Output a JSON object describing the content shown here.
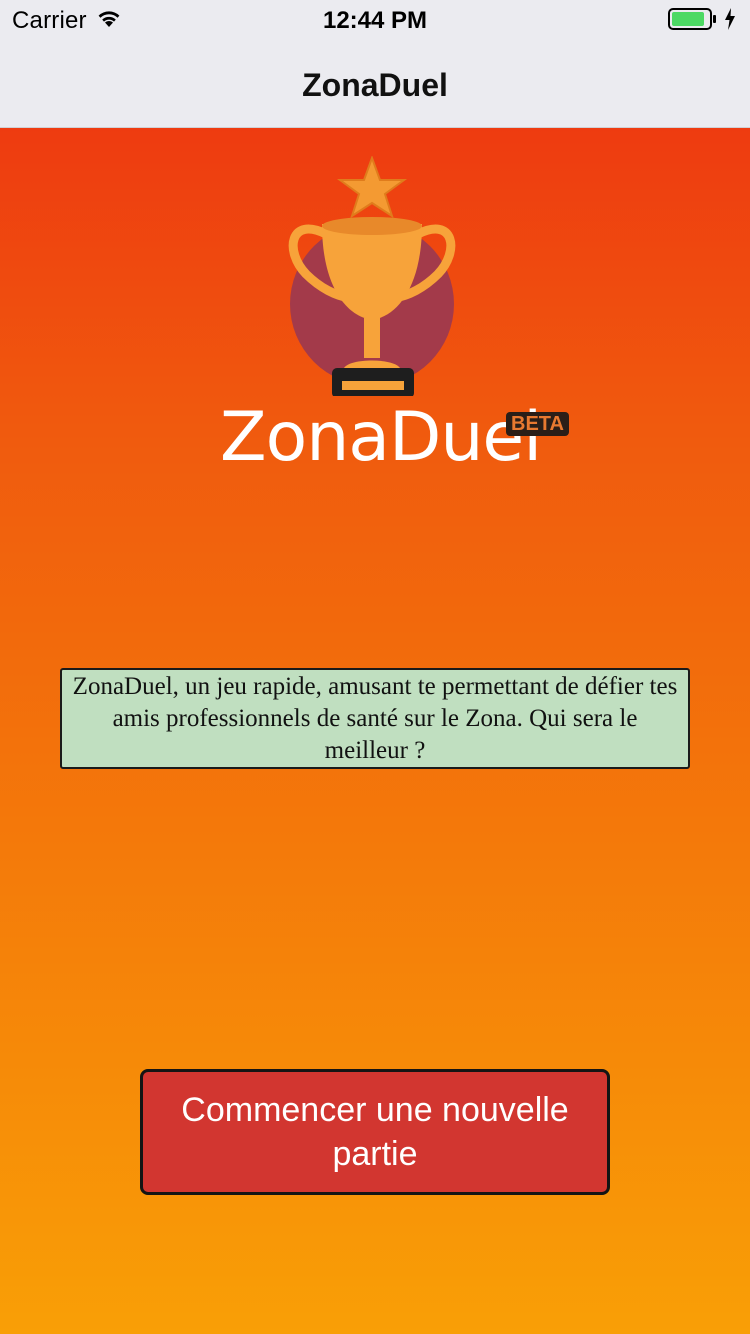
{
  "status_bar": {
    "carrier": "Carrier",
    "time": "12:44 PM",
    "battery_color": "#4cd964"
  },
  "nav": {
    "title": "ZonaDuel"
  },
  "logo": {
    "brand_text": "ZonaDuel",
    "badge": "BETA",
    "trophy_color": "#f7a33a",
    "circle_color": "#a33a4a"
  },
  "intro": {
    "text": "ZonaDuel, un jeu rapide, amusant te permettant de défier tes amis professionnels de santé sur le Zona. Qui sera le meilleur ?",
    "background": "#c0dfc0"
  },
  "actions": {
    "start_label": "Commencer une nouvelle partie",
    "start_color": "#d23630"
  }
}
